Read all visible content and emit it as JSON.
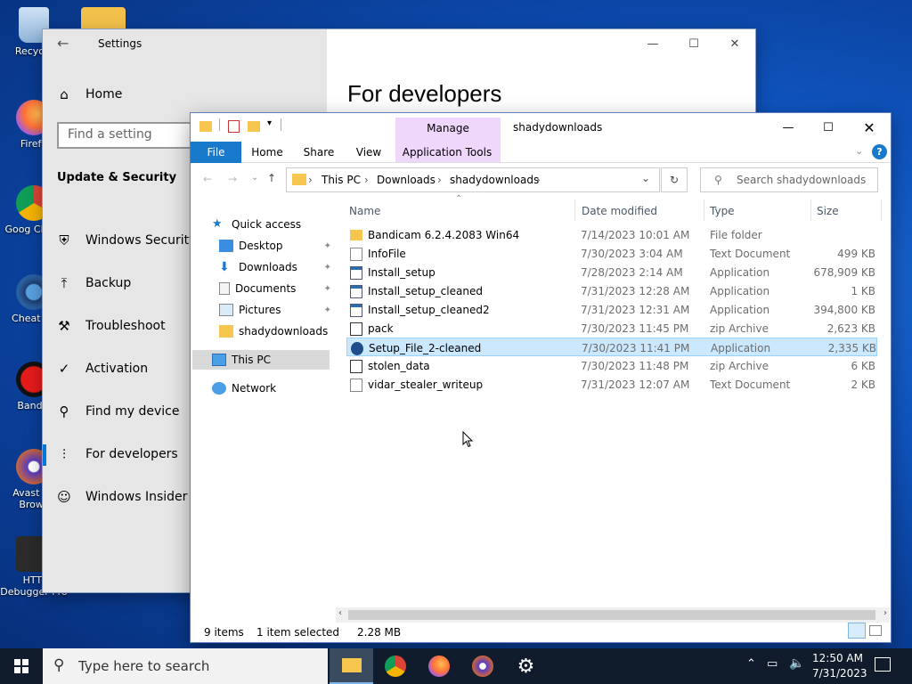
{
  "desktop": {
    "icons": [
      {
        "label": "Recycle"
      },
      {
        "label": "Firefo"
      },
      {
        "label": "Goog Chron"
      },
      {
        "label": "Cheat En"
      },
      {
        "label": "Bandic"
      },
      {
        "label": "Avast Se Brows"
      },
      {
        "label": "HTTI Debugger Pro"
      }
    ]
  },
  "settings": {
    "title": "Settings",
    "home": "Home",
    "search_placeholder": "Find a setting",
    "section": "Update & Security",
    "nav": [
      "Windows Security",
      "Backup",
      "Troubleshoot",
      "Activation",
      "Find my device",
      "For developers",
      "Windows Insider Pr"
    ],
    "page_title": "For developers"
  },
  "explorer": {
    "title": "shadydownloads",
    "context_tab_group": "Manage",
    "tabs": [
      "File",
      "Home",
      "Share",
      "View",
      "Application Tools"
    ],
    "breadcrumb": [
      "This PC",
      "Downloads",
      "shadydownloads"
    ],
    "search_placeholder": "Search shadydownloads",
    "nav": {
      "quick_access": "Quick access",
      "pinned": [
        "Desktop",
        "Downloads",
        "Documents",
        "Pictures"
      ],
      "folder": "shadydownloads",
      "this_pc": "This PC",
      "network": "Network"
    },
    "columns": [
      "Name",
      "Date modified",
      "Type",
      "Size"
    ],
    "files": [
      {
        "name": "Bandicam 6.2.4.2083 Win64",
        "date": "7/14/2023 10:01 AM",
        "type": "File folder",
        "size": "",
        "icon": "folder"
      },
      {
        "name": "InfoFile",
        "date": "7/30/2023 3:04 AM",
        "type": "Text Document",
        "size": "499 KB",
        "icon": "text"
      },
      {
        "name": "Install_setup",
        "date": "7/28/2023 2:14 AM",
        "type": "Application",
        "size": "678,909 KB",
        "icon": "app"
      },
      {
        "name": "Install_setup_cleaned",
        "date": "7/31/2023 12:28 AM",
        "type": "Application",
        "size": "1 KB",
        "icon": "app"
      },
      {
        "name": "Install_setup_cleaned2",
        "date": "7/31/2023 12:31 AM",
        "type": "Application",
        "size": "394,800 KB",
        "icon": "app"
      },
      {
        "name": "pack",
        "date": "7/30/2023 11:45 PM",
        "type": "zip Archive",
        "size": "2,623 KB",
        "icon": "zip"
      },
      {
        "name": "Setup_File_2-cleaned",
        "date": "7/30/2023 11:41 PM",
        "type": "Application",
        "size": "2,335 KB",
        "icon": "setup"
      },
      {
        "name": "stolen_data",
        "date": "7/30/2023 11:48 PM",
        "type": "zip Archive",
        "size": "6 KB",
        "icon": "zip"
      },
      {
        "name": "vidar_stealer_writeup",
        "date": "7/31/2023 12:07 AM",
        "type": "Text Document",
        "size": "2 KB",
        "icon": "text"
      }
    ],
    "status": {
      "count": "9 items",
      "selection": "1 item selected",
      "size": "2.28 MB"
    }
  },
  "taskbar": {
    "search_placeholder": "Type here to search",
    "time": "12:50 AM",
    "date": "7/31/2023"
  },
  "colors": {
    "accent": "#0078d7",
    "selection": "#cce8ff",
    "manage_band": "#efd6fb",
    "taskbar": "#101c2b"
  }
}
